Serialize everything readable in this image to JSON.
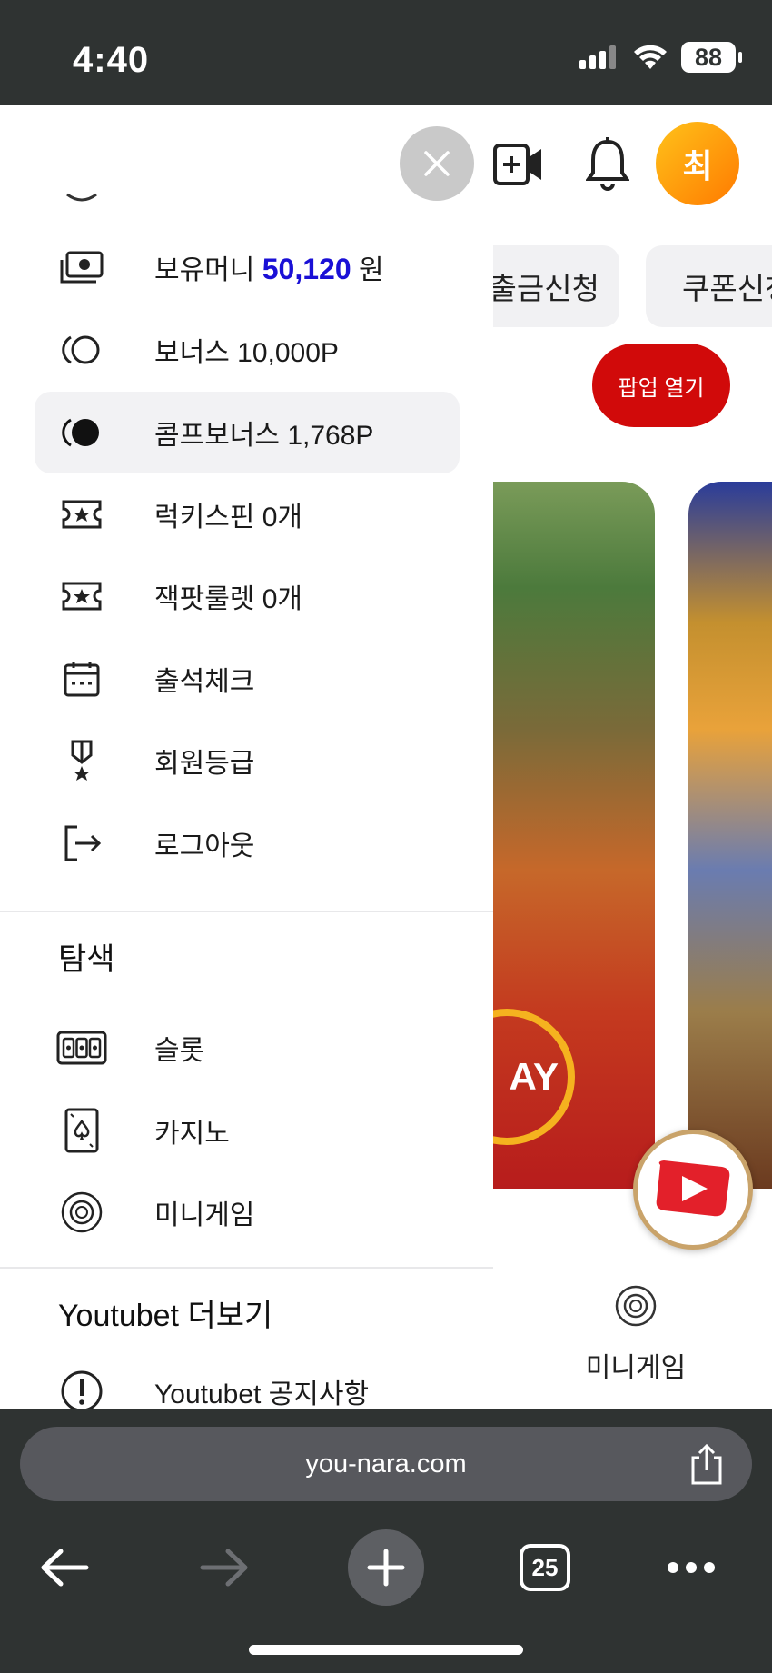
{
  "status_bar": {
    "time": "4:40",
    "battery": "88"
  },
  "header": {
    "avatar_initial": "최"
  },
  "background": {
    "pill_withdraw": "출금신청",
    "pill_coupon": "쿠폰신청",
    "popup_button": "팝업 열기",
    "banner_text": "AY",
    "minigame_label": "미니게임"
  },
  "drawer": {
    "money": {
      "prefix": "보유머니",
      "value": "50,120",
      "unit": "원"
    },
    "items": [
      {
        "label": "보너스 10,000P"
      },
      {
        "label": "콤프보너스 1,768P"
      },
      {
        "label": "럭키스핀 0개"
      },
      {
        "label": "잭팟룰렛 0개"
      },
      {
        "label": "출석체크"
      },
      {
        "label": "회원등급"
      },
      {
        "label": "로그아웃"
      }
    ],
    "explore_title": "탐색",
    "explore_items": [
      {
        "label": "슬롯"
      },
      {
        "label": "카지노"
      },
      {
        "label": "미니게임"
      }
    ],
    "more_title": "Youtubet 더보기",
    "more_items": [
      {
        "label": "Youtubet 공지사항"
      }
    ]
  },
  "browser": {
    "url": "you-nara.com",
    "tab_count": "25"
  },
  "colors": {
    "money_blue": "#1a10d6",
    "popup_red": "#d10a0a",
    "avatar_orange": "#ff9a0a"
  }
}
